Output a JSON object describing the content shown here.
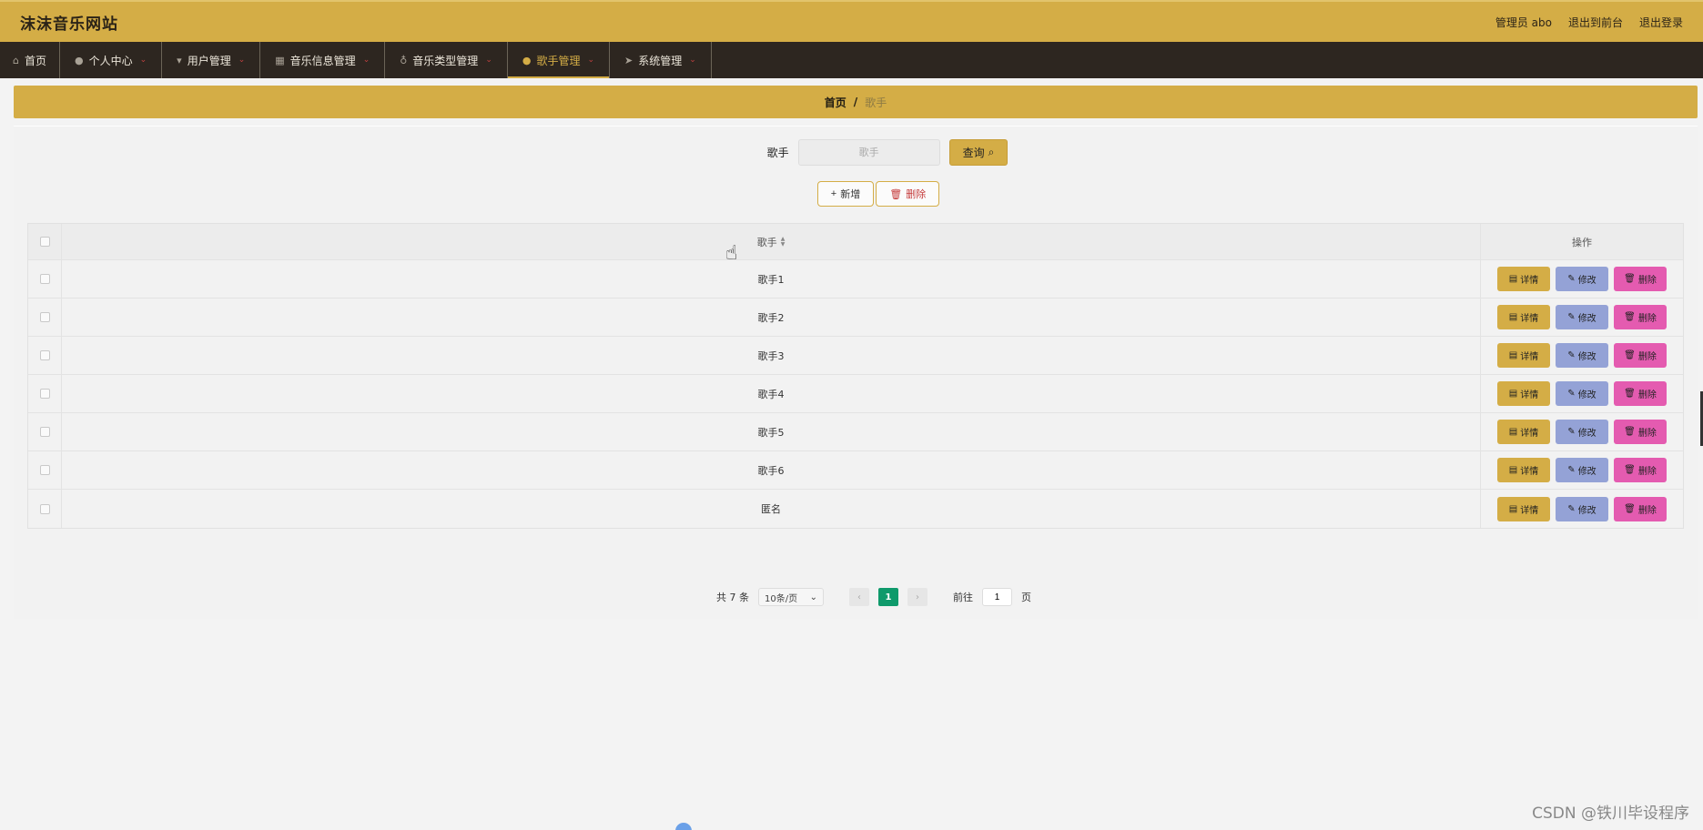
{
  "header": {
    "site_title": "沫沫音乐网站",
    "links": [
      "管理员 abo",
      "退出到前台",
      "退出登录"
    ]
  },
  "nav": {
    "items": [
      {
        "label": "首页",
        "icon": "home-icon"
      },
      {
        "label": "个人中心",
        "icon": "user-icon"
      },
      {
        "label": "用户管理",
        "icon": "users-icon"
      },
      {
        "label": "音乐信息管理",
        "icon": "calendar-icon"
      },
      {
        "label": "音乐类型管理",
        "icon": "mic-icon"
      },
      {
        "label": "歌手管理",
        "icon": "location-icon",
        "active": true
      },
      {
        "label": "系统管理",
        "icon": "send-icon"
      }
    ]
  },
  "breadcrumb": {
    "home": "首页",
    "sep": "/",
    "current": "歌手"
  },
  "search": {
    "label": "歌手",
    "placeholder": "歌手",
    "button": "查询"
  },
  "actions": {
    "add": "新增",
    "delete": "删除"
  },
  "table": {
    "columns": [
      "歌手",
      "操作"
    ],
    "rows": [
      "歌手1",
      "歌手2",
      "歌手3",
      "歌手4",
      "歌手5",
      "歌手6",
      "匿名"
    ],
    "op_labels": {
      "detail": "详情",
      "edit": "修改",
      "remove": "删除"
    }
  },
  "pager": {
    "total": "共 7 条",
    "page_size": "10条/页",
    "current_page": "1",
    "goto_label": "前往",
    "goto_value": "1",
    "page_unit": "页"
  },
  "watermark": "CSDN @铁川毕设程序",
  "colors": {
    "brand": "#d4ad46",
    "nav_bg": "#2d2620",
    "edit": "#94a2d6",
    "remove": "#e45bb0",
    "page_active": "#0f9a6b"
  }
}
